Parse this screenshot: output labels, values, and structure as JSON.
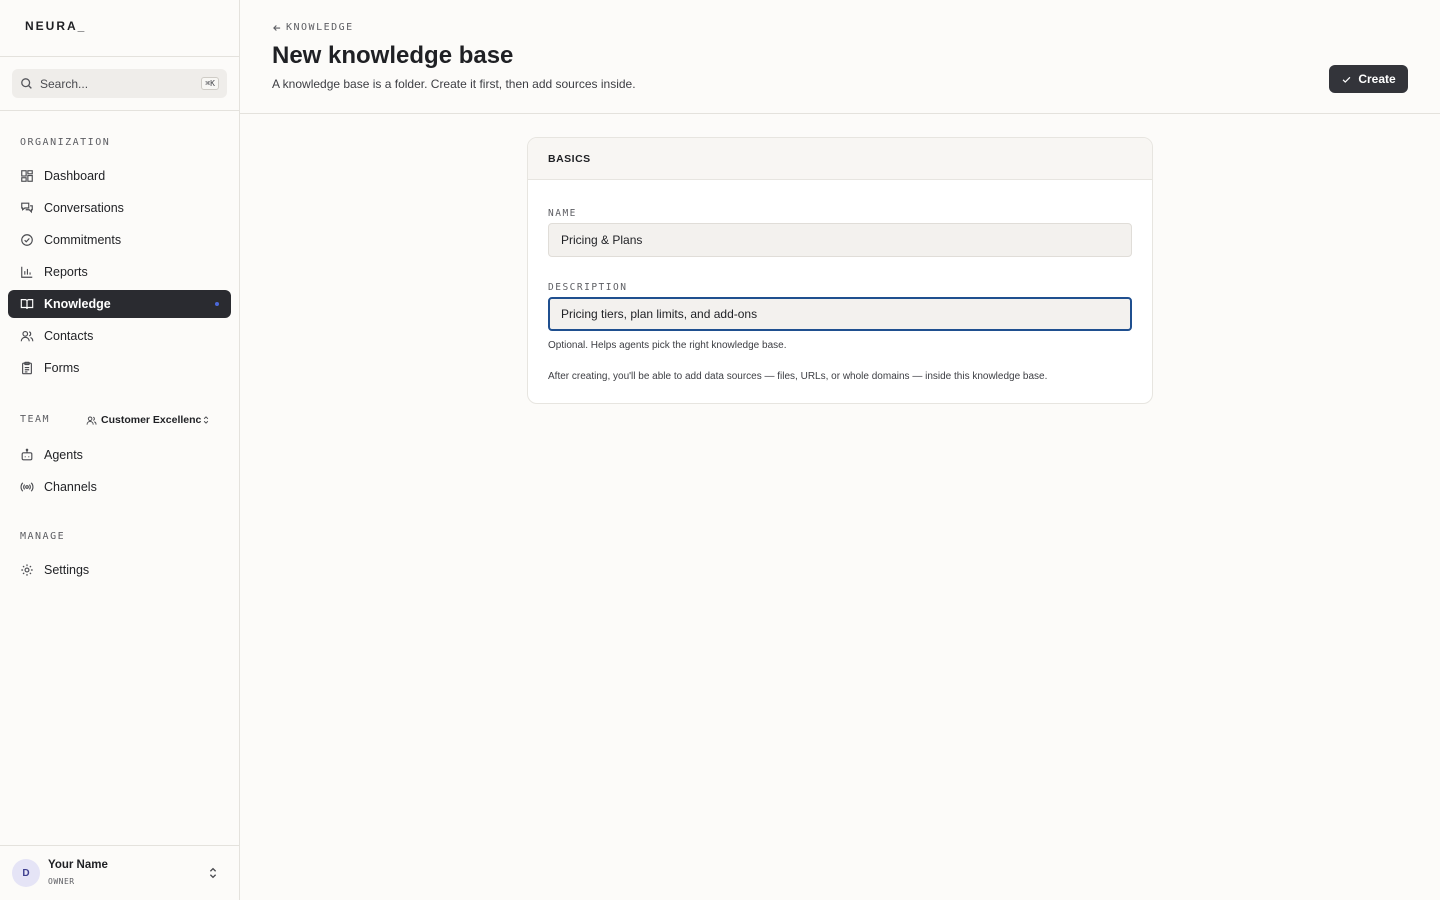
{
  "brand": {
    "logo": "NEURA_"
  },
  "search": {
    "placeholder": "Search...",
    "shortcut": "⌘K"
  },
  "sidebar": {
    "organization_label": "ORGANIZATION",
    "org_items": [
      {
        "label": "Dashboard",
        "icon": "dashboard-icon"
      },
      {
        "label": "Conversations",
        "icon": "chat-icon"
      },
      {
        "label": "Commitments",
        "icon": "check-circle-icon"
      },
      {
        "label": "Reports",
        "icon": "bar-chart-icon"
      },
      {
        "label": "Knowledge",
        "icon": "book-icon",
        "active": true
      },
      {
        "label": "Contacts",
        "icon": "users-icon"
      },
      {
        "label": "Forms",
        "icon": "clipboard-icon"
      }
    ],
    "team_label": "TEAM",
    "team_selected": "Customer Excellence",
    "team_items": [
      {
        "label": "Agents",
        "icon": "bot-icon"
      },
      {
        "label": "Channels",
        "icon": "radio-icon"
      }
    ],
    "manage_label": "MANAGE",
    "manage_items": [
      {
        "label": "Settings",
        "icon": "gear-icon"
      }
    ]
  },
  "user": {
    "initial": "D",
    "name": "Your Name",
    "role": "OWNER"
  },
  "header": {
    "back_label": "KNOWLEDGE",
    "title": "New knowledge base",
    "subtitle": "A knowledge base is a folder. Create it first, then add sources inside.",
    "create_label": "Create"
  },
  "form": {
    "section_title": "BASICS",
    "name_label": "NAME",
    "name_value": "Pricing & Plans",
    "description_label": "DESCRIPTION",
    "description_value": "Pricing tiers, plan limits, and add-ons",
    "description_hint": "Optional. Helps agents pick the right knowledge base.",
    "after_note": "After creating, you'll be able to add data sources — files, URLs, or whole domains — inside this knowledge base."
  },
  "colors": {
    "accent": "#1f4f8f",
    "active_nav": "#2a2b30",
    "active_dot": "#4b68d9",
    "background": "#fcfbf9"
  }
}
